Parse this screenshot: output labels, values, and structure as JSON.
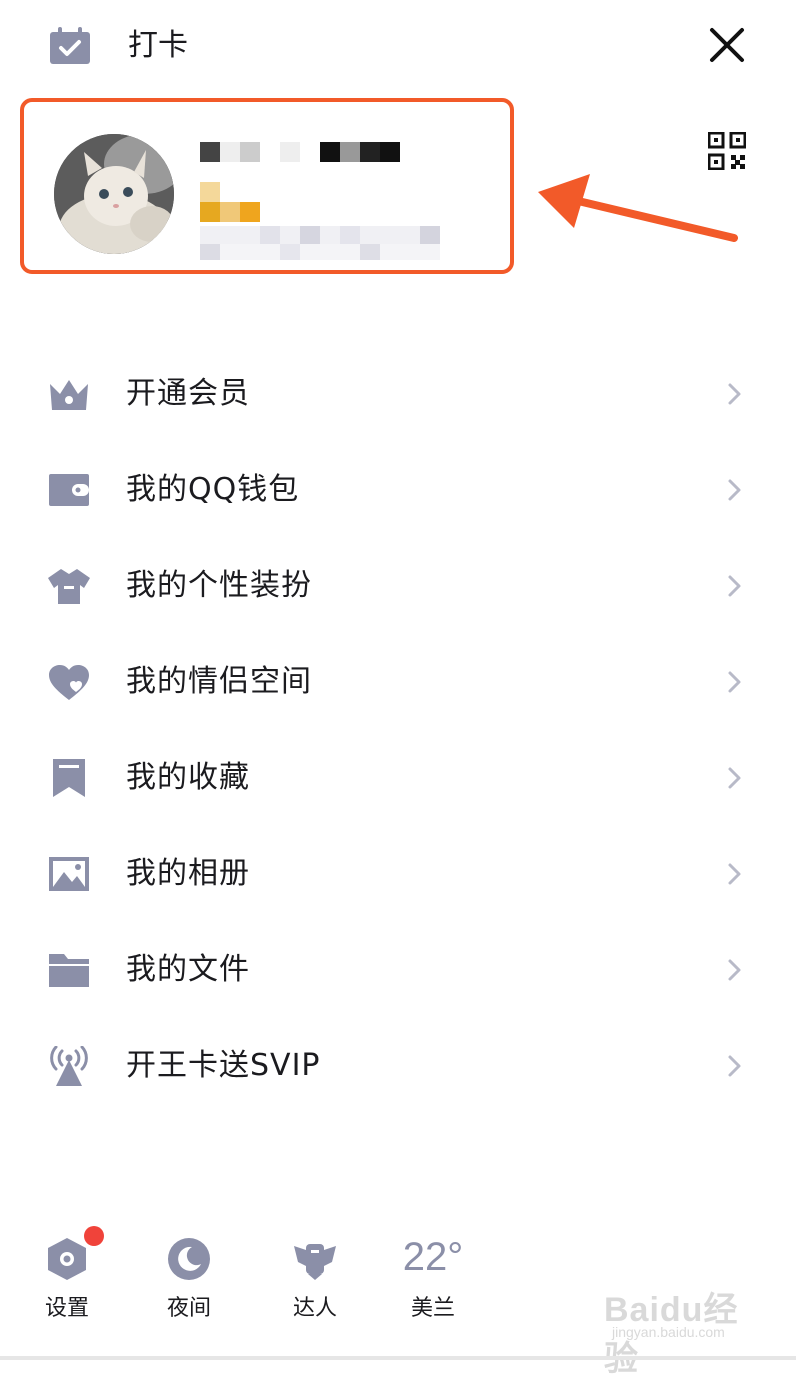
{
  "header": {
    "checkin_label": "打卡",
    "checkin_icon": "calendar-check-icon",
    "close_icon": "close-icon"
  },
  "profile": {
    "avatar": "cat-avatar",
    "qr_icon": "qr-code-icon",
    "highlight_color": "#f25a29"
  },
  "menu": {
    "items": [
      {
        "label": "开通会员",
        "icon": "crown-icon"
      },
      {
        "label": "我的QQ钱包",
        "icon": "wallet-icon"
      },
      {
        "label": "我的个性装扮",
        "icon": "shirt-icon"
      },
      {
        "label": "我的情侣空间",
        "icon": "heart-icon"
      },
      {
        "label": "我的收藏",
        "icon": "bookmark-icon"
      },
      {
        "label": "我的相册",
        "icon": "photo-icon"
      },
      {
        "label": "我的文件",
        "icon": "folder-icon"
      },
      {
        "label": "开王卡送SVIP",
        "icon": "signal-tower-icon"
      }
    ]
  },
  "toolbar": {
    "settings_label": "设置",
    "night_label": "夜间",
    "expert_label": "达人",
    "weather_temp": "22°",
    "weather_city": "美兰"
  },
  "watermark": {
    "brand": "Baidu经验",
    "url": "jingyan.baidu.com"
  },
  "colors": {
    "icon_gray": "#8b8fa8",
    "accent_red": "#f25a29",
    "badge_red": "#f0433a"
  }
}
